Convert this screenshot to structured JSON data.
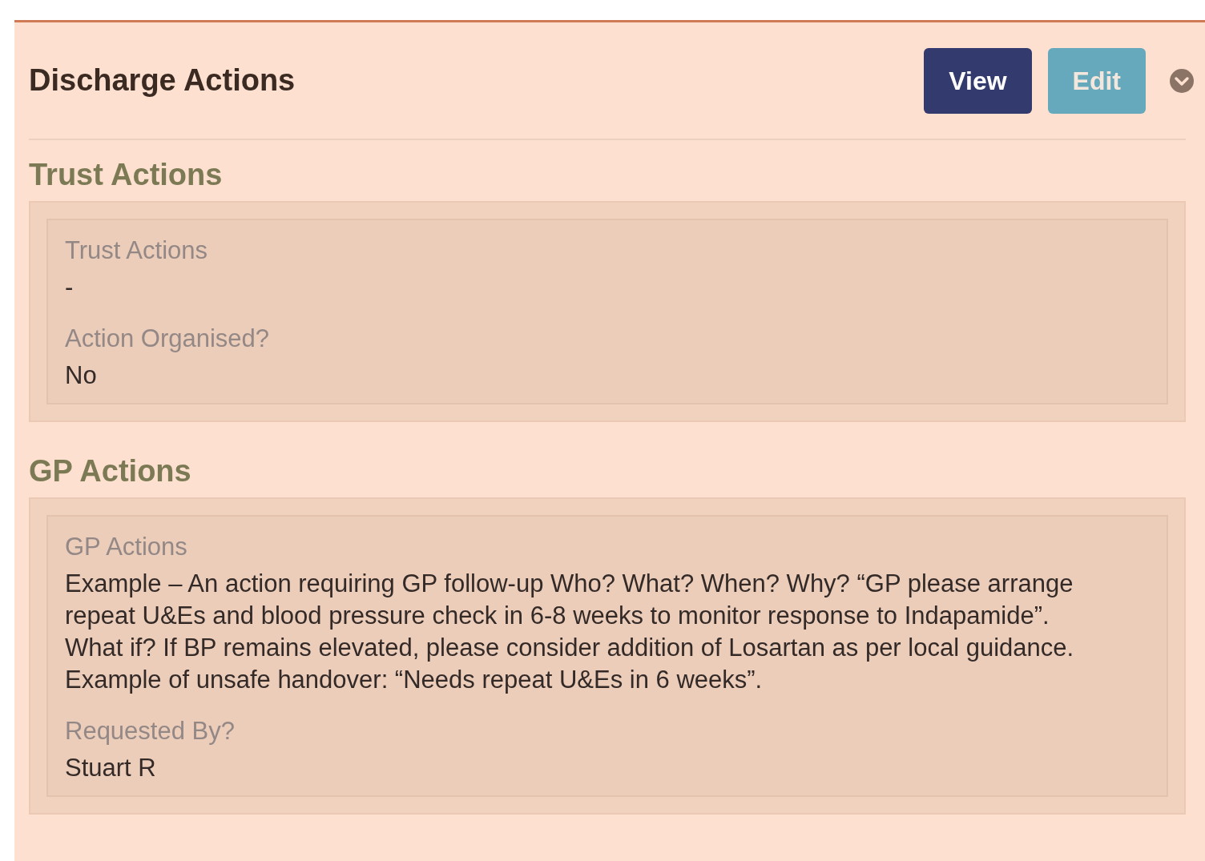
{
  "panel": {
    "title": "Discharge Actions",
    "buttons": [
      {
        "label": "View",
        "kind": "primary"
      },
      {
        "label": "Edit",
        "kind": "info"
      }
    ],
    "sections": [
      {
        "title": "Trust Actions",
        "fields": [
          {
            "label": "Trust Actions",
            "value": "-"
          },
          {
            "label": "Action Organised?",
            "value": "No"
          }
        ]
      },
      {
        "title": "GP Actions",
        "fields": [
          {
            "label": "GP Actions",
            "value": "Example – An action requiring GP follow-up Who? What? When? Why? “GP please arrange repeat U&Es and blood pressure check in 6-8 weeks to monitor response to Indapamide”. What if? If BP remains elevated, please consider addition of Losartan as per local guidance. Example of unsafe handover: “Needs repeat U&Es in 6 weeks”."
          },
          {
            "label": "Requested By?",
            "value": "Stuart R"
          }
        ]
      }
    ]
  }
}
